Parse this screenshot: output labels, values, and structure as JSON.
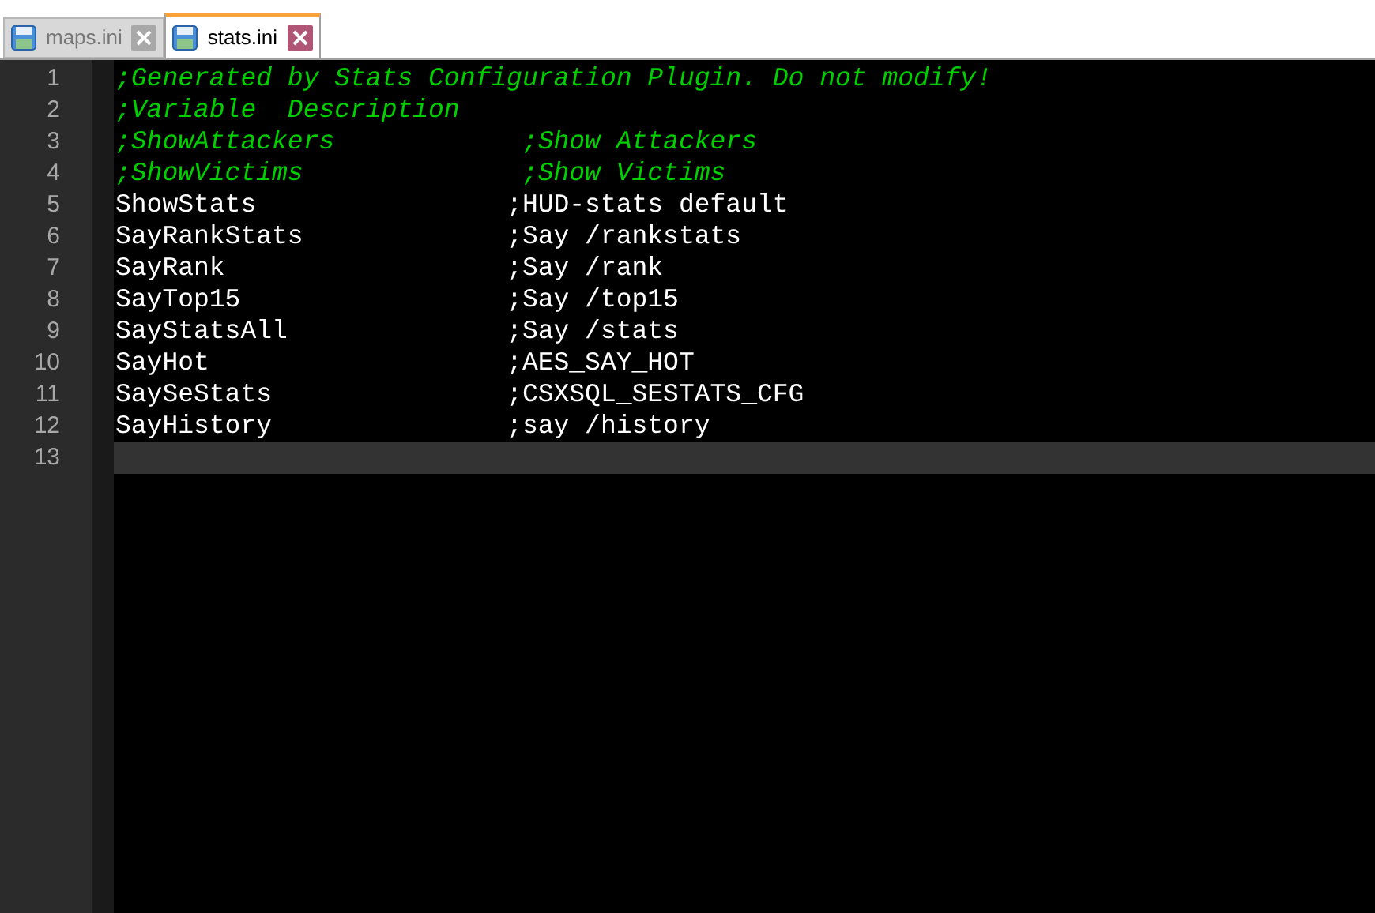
{
  "tabs": [
    {
      "label": "maps.ini",
      "selected": false
    },
    {
      "label": "stats.ini",
      "selected": true
    }
  ],
  "editor": {
    "lines": [
      {
        "number": "1",
        "kind": "comment",
        "text": ";Generated by Stats Configuration Plugin. Do not modify!",
        "current": false
      },
      {
        "number": "2",
        "kind": "comment",
        "text": ";Variable  Description",
        "current": false
      },
      {
        "number": "3",
        "kind": "comment",
        "text": ";ShowAttackers            ;Show Attackers",
        "current": false
      },
      {
        "number": "4",
        "kind": "comment",
        "text": ";ShowVictims              ;Show Victims",
        "current": false
      },
      {
        "number": "5",
        "kind": "code",
        "text": "ShowStats                ;HUD-stats default",
        "current": false
      },
      {
        "number": "6",
        "kind": "code",
        "text": "SayRankStats             ;Say /rankstats",
        "current": false
      },
      {
        "number": "7",
        "kind": "code",
        "text": "SayRank                  ;Say /rank",
        "current": false
      },
      {
        "number": "8",
        "kind": "code",
        "text": "SayTop15                 ;Say /top15",
        "current": false
      },
      {
        "number": "9",
        "kind": "code",
        "text": "SayStatsAll              ;Say /stats",
        "current": false
      },
      {
        "number": "10",
        "kind": "code",
        "text": "SayHot                   ;AES_SAY_HOT",
        "current": false
      },
      {
        "number": "11",
        "kind": "code",
        "text": "SaySeStats               ;CSXSQL_SESTATS_CFG",
        "current": false
      },
      {
        "number": "12",
        "kind": "code",
        "text": "SayHistory               ;say /history",
        "current": false
      },
      {
        "number": "13",
        "kind": "code",
        "current": true
      }
    ]
  }
}
